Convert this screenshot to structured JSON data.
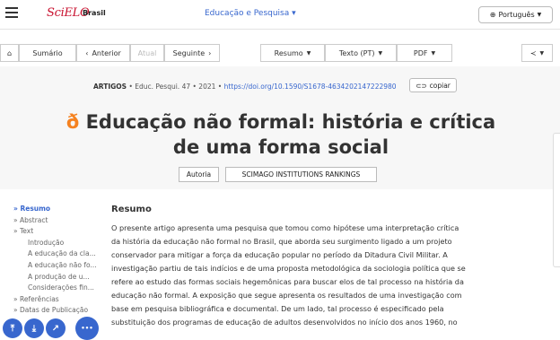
{
  "topbar": {
    "logo_text": "SciELO",
    "logo_country": "Brasil",
    "collection": "Educação e Pesquisa ▾",
    "language": "Português"
  },
  "navbar": {
    "summary": "Sumário",
    "previous": "Anterior",
    "current": "Atual",
    "next": "Seguinte",
    "abstract_menu": "Resumo",
    "text_menu": "Texto (PT)",
    "pdf_menu": "PDF"
  },
  "article": {
    "type": "ARTIGOS",
    "meta": " • Educ. Pesqui. 47 • 2021 • ",
    "doi": "https://doi.org/10.1590/S1678-4634202147222980",
    "copy_label": "copiar",
    "title": "Educação não formal: história e crítica de uma forma social",
    "authorship_btn": "Autoria",
    "scimago_btn": "SCIMAGO INSTITUTIONS RANKINGS"
  },
  "toc": {
    "items": [
      {
        "label": "» Resumo",
        "active": true
      },
      {
        "label": "» Abstract"
      },
      {
        "label": "» Text"
      },
      {
        "label": "Introdução",
        "sub": true
      },
      {
        "label": "A educação da cla...",
        "sub": true
      },
      {
        "label": "A educação não fo...",
        "sub": true
      },
      {
        "label": "A produção de u...",
        "sub": true
      },
      {
        "label": "Considerações fin...",
        "sub": true
      },
      {
        "label": "» Referências"
      },
      {
        "label": "» Datas de Publicação"
      }
    ]
  },
  "content": {
    "section_title": "Resumo",
    "abstract_lines": [
      "O presente artigo apresenta uma pesquisa que tomou como hipótese uma interpretação crítica",
      "da história da educação não formal no Brasil, que aborda seu surgimento ligado a um projeto",
      "conservador para mitigar a força da educação popular no período da Ditadura Civil Militar. A",
      "investigação partiu de tais indícios e de uma proposta metodológica da sociologia política que se",
      "refere ao estudo das formas sociais hegemônicas para buscar elos de tal processo na história da",
      "educação não formal. A exposição que segue apresenta os resultados de uma investigação com",
      "base em pesquisa bibliográfica e documental. De um lado, tal processo é especificado pela",
      "substituição dos programas de educação de adultos desenvolvidos no início dos anos 1960, no"
    ]
  },
  "fabs": {
    "top": "⤒",
    "download": "⤓",
    "metrics": "↗",
    "more": "•••"
  },
  "colors": {
    "accent": "#3867ce",
    "brand": "#c8102e",
    "open_access": "#f58220"
  }
}
